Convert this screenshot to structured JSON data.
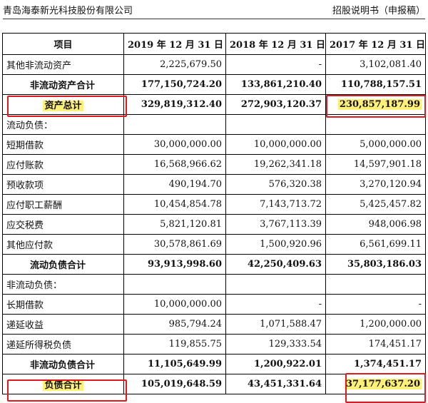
{
  "header": {
    "company": "青岛海泰新光科技股份有限公司",
    "doc_type": "招股说明书（申报稿）"
  },
  "table": {
    "columns": [
      "项目",
      "2019 年 12 月 31 日",
      "2018 年 12 月 31 日",
      "2017 年 12 月 31 日"
    ],
    "rows": [
      {
        "item": "其他非流动资产",
        "v2019": "2,225,679.50",
        "v2018": "-",
        "v2017": "3,102,081.40"
      },
      {
        "item": "非流动资产合计",
        "v2019": "177,150,724.20",
        "v2018": "133,861,210.40",
        "v2017": "110,788,157.51"
      },
      {
        "item": "资产总计",
        "v2019": "329,819,312.40",
        "v2018": "272,903,120.37",
        "v2017": "230,857,187.99"
      },
      {
        "item": "流动负债：",
        "v2019": "",
        "v2018": "",
        "v2017": ""
      },
      {
        "item": "短期借款",
        "v2019": "30,000,000.00",
        "v2018": "10,000,000.00",
        "v2017": "5,000,000.00"
      },
      {
        "item": "应付账款",
        "v2019": "16,568,966.62",
        "v2018": "19,262,341.18",
        "v2017": "14,597,901.18"
      },
      {
        "item": "预收款项",
        "v2019": "490,194.70",
        "v2018": "576,320.38",
        "v2017": "3,270,120.94"
      },
      {
        "item": "应付职工薪酬",
        "v2019": "10,454,854.78",
        "v2018": "7,143,713.72",
        "v2017": "5,425,457.82"
      },
      {
        "item": "应交税费",
        "v2019": "5,821,120.81",
        "v2018": "3,767,113.39",
        "v2017": "948,006.98"
      },
      {
        "item": "其他应付款",
        "v2019": "30,578,861.69",
        "v2018": "1,500,920.96",
        "v2017": "6,561,699.11"
      },
      {
        "item": "流动负债合计",
        "v2019": "93,913,998.60",
        "v2018": "42,250,409.63",
        "v2017": "35,803,186.03"
      },
      {
        "item": "非流动负债：",
        "v2019": "",
        "v2018": "",
        "v2017": ""
      },
      {
        "item": "长期借款",
        "v2019": "10,000,000.00",
        "v2018": "-",
        "v2017": "-"
      },
      {
        "item": "递延收益",
        "v2019": "985,794.24",
        "v2018": "1,071,588.47",
        "v2017": "1,200,000.00"
      },
      {
        "item": "递延所得税负债",
        "v2019": "119,855.75",
        "v2018": "129,333.54",
        "v2017": "174,451.17"
      },
      {
        "item": "非流动负债合计",
        "v2019": "11,105,649.99",
        "v2018": "1,200,922.01",
        "v2017": "1,374,451.17"
      },
      {
        "item": "负债合计",
        "v2019": "105,019,648.59",
        "v2018": "43,451,331.64",
        "v2017": "37,177,637.20"
      }
    ]
  },
  "highlight_color": "#fff178",
  "box_color": "#e0191f"
}
